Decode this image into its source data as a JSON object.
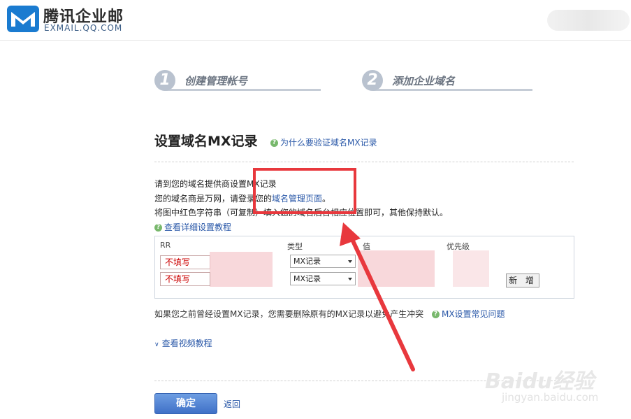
{
  "header": {
    "logo_cn": "腾讯企业邮",
    "logo_en": "EXMAIL.QQ.COM"
  },
  "steps": [
    {
      "num": "1",
      "label": "创建管理帐号"
    },
    {
      "num": "2",
      "label": "添加企业域名"
    }
  ],
  "page": {
    "title": "设置域名MX记录",
    "why_link": "为什么要验证域名MX记录"
  },
  "instructions": {
    "line1": "请到您的域名提供商设置MX记录",
    "line2_prefix": "您的域名商是万网，请登录您的",
    "line2_link": "域名管理页面",
    "line2_suffix": "。",
    "line3": "将图中红色字符串（可复制）填入您的域名后台相应位置即可，其他保持默认。",
    "tutorial_link": "查看详细设置教程"
  },
  "table": {
    "headers": [
      "RR",
      "类型",
      "值",
      "优先级"
    ],
    "rows": [
      {
        "rr": "不填写",
        "type": "MX记录"
      },
      {
        "rr": "不填写",
        "type": "MX记录"
      }
    ],
    "add_button": "新 增"
  },
  "notice": {
    "text": "如果您之前曾经设置MX记录，您需要删除原有的MX记录以避免产生冲突",
    "faq_link": "MX设置常见问题"
  },
  "video_link": "查看视频教程",
  "actions": {
    "confirm": "确定",
    "back": "返回"
  },
  "watermark": {
    "main": "Baidu经验",
    "sub": "jingyan.baidu.com"
  },
  "colors": {
    "accent": "#2a58a8",
    "highlight": "#e8383d",
    "warning_text": "#cc0000"
  }
}
